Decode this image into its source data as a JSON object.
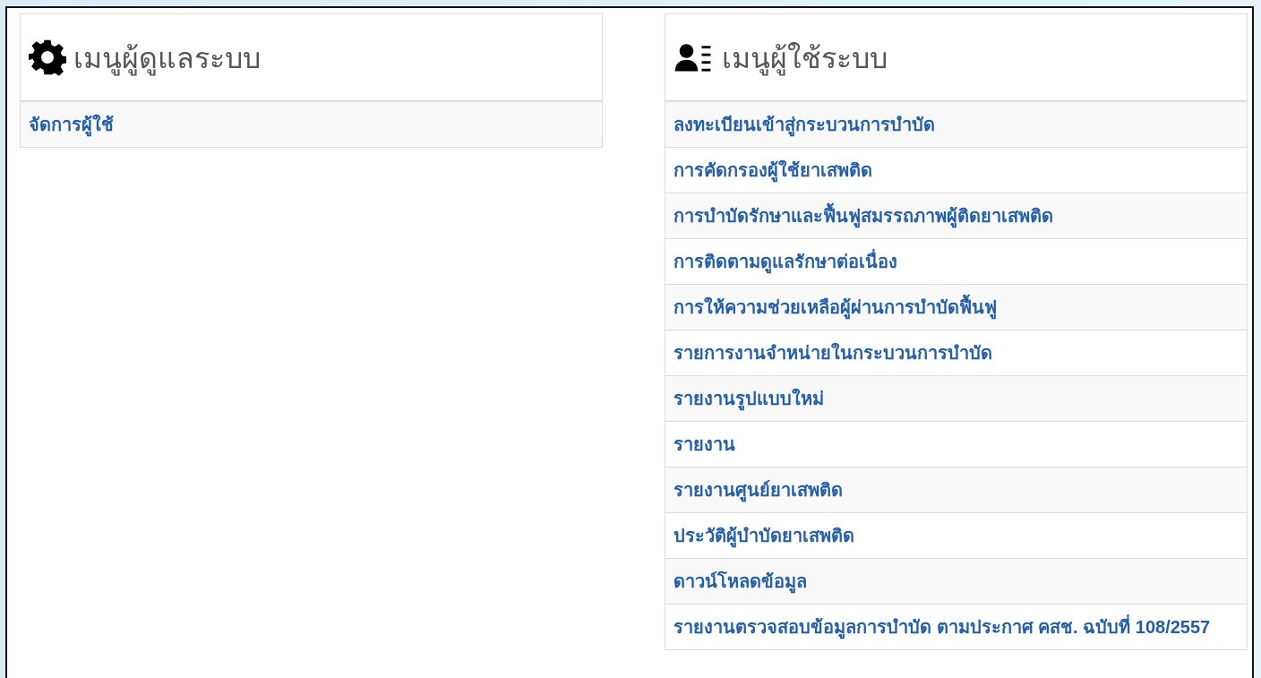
{
  "admin_panel": {
    "title": "เมนูผู้ดูแลระบบ",
    "items": [
      {
        "label": "จัดการผู้ใช้"
      }
    ]
  },
  "user_panel": {
    "title": "เมนูผู้ใช้ระบบ",
    "items": [
      {
        "label": "ลงทะเบียนเข้าสู่กระบวนการบำบัด"
      },
      {
        "label": "การคัดกรองผู้ใช้ยาเสพติด"
      },
      {
        "label": "การบำบัดรักษาและฟื้นฟูสมรรถภาพผู้ติดยาเสพติด"
      },
      {
        "label": "การติดตามดูแลรักษาต่อเนื่อง"
      },
      {
        "label": "การให้ความช่วยเหลือผู้ผ่านการบำบัดฟื้นฟู"
      },
      {
        "label": "รายการงานจำหน่ายในกระบวนการบำบัด"
      },
      {
        "label": "รายงานรูปแบบใหม่"
      },
      {
        "label": "รายงาน"
      },
      {
        "label": "รายงานศูนย์ยาเสพติด"
      },
      {
        "label": "ประวัติผู้บำบัดยาเสพติด"
      },
      {
        "label": "ดาวน์โหลดข้อมูล"
      },
      {
        "label": "รายงานตรวจสอบข้อมูลการบำบัด ตามประกาศ คสช. ฉบับที่ 108/2557"
      }
    ]
  }
}
